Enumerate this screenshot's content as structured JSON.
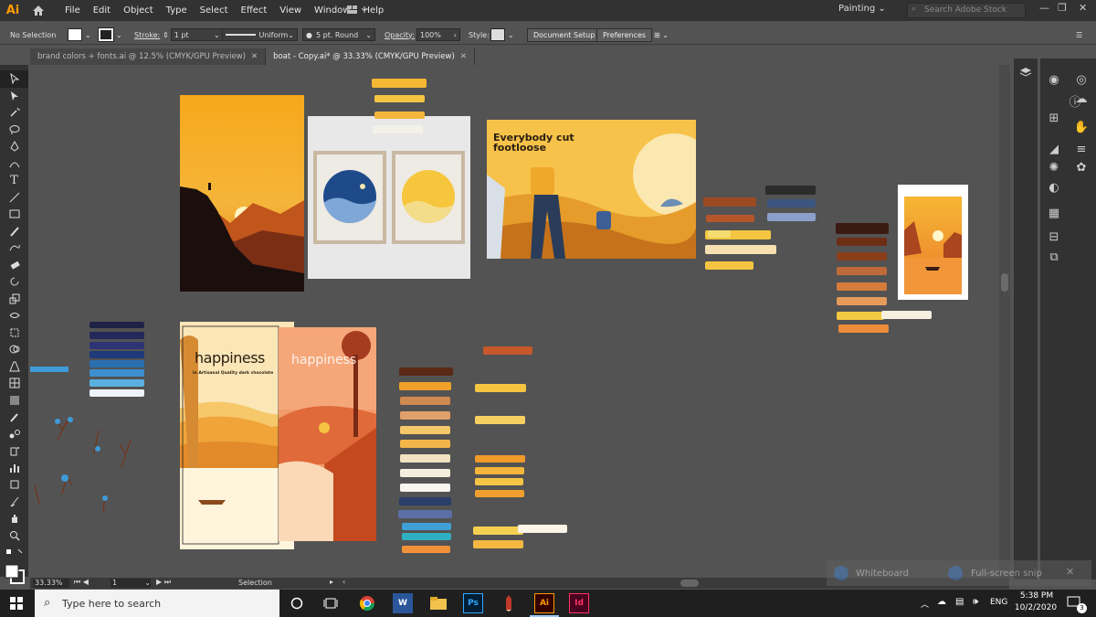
{
  "app": {
    "logo": "Ai",
    "workspace": "Painting",
    "stock_placeholder": "Search Adobe Stock"
  },
  "menu": [
    "File",
    "Edit",
    "Object",
    "Type",
    "Select",
    "Effect",
    "View",
    "Window",
    "Help"
  ],
  "control": {
    "selection": "No Selection",
    "stroke_label": "Stroke:",
    "stroke_weight": "1 pt",
    "stroke_profile": "Uniform",
    "brush": "5 pt. Round",
    "opacity_label": "Opacity:",
    "opacity": "100%",
    "style_label": "Style:",
    "document_setup": "Document Setup",
    "preferences": "Preferences"
  },
  "tabs": [
    {
      "label": "brand colors + fonts.ai @ 12.5% (CMYK/GPU Preview)",
      "active": false
    },
    {
      "label": "boat - Copy.ai* @ 33.33% (CMYK/GPU Preview)",
      "active": true
    }
  ],
  "artwork": {
    "poster_title": "Everybody cut\nfootloose",
    "brand_name_1": "happiness",
    "brand_tag_1": "in Artisanal Quality dark chocolate",
    "brand_name_2": "happiness"
  },
  "status": {
    "zoom": "33.33%",
    "artboard": "1",
    "mode": "Selection"
  },
  "overlay": {
    "whiteboard": "Whiteboard",
    "snip": "Full-screen snip"
  },
  "taskbar": {
    "search_placeholder": "Type here to search",
    "lang": "ENG",
    "time": "5:38 PM",
    "date": "10/2/2020",
    "notifications": "3"
  },
  "colors": {
    "accent": "#ff9a00",
    "orange": "#f6a21e",
    "yellow": "#f5c542",
    "navy": "#1e2345"
  }
}
